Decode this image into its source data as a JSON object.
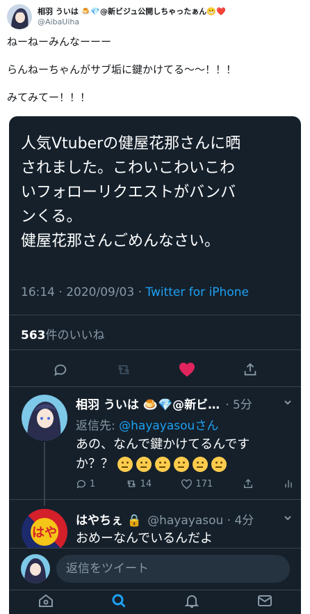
{
  "outer_tweet": {
    "name": "相羽 ういは 🍮💎@新ビジュ公開しちゃったぁん😬❤️",
    "handle": "@AibaUiha",
    "lines": [
      "ねーねーみんなーーー",
      "らんねーちゃんがサブ垢に鍵かけてる〜〜！！！",
      "みてみてー！！！"
    ]
  },
  "screenshot": {
    "tweet_lines": [
      "人気Vtuberの健屋花那さんに晒",
      "されました。こわいこわいこわ",
      "いフォローリクエストがバンバ",
      "ンくる。",
      "健屋花那さんごめんなさい。"
    ],
    "time": "16:14 · 2020/09/03 · ",
    "source": "Twitter for iPhone",
    "likes_count": "563",
    "likes_label": "件のいいね",
    "reply": {
      "name": "相羽 ういは 🍮💎@新ビ…",
      "time": "· 5分",
      "replying_prefix": "返信先: ",
      "replying_handle": "@hayayasou",
      "replying_suffix": "さん",
      "text_line1": "あの、なんで鍵かけてるんです",
      "text_line2": "か？？",
      "reply_count": "1",
      "retweet_count": "14",
      "like_count": "171"
    },
    "reply2": {
      "name": "はやちぇ 🔒",
      "handle_time": "@hayayasou · 4分",
      "text": "おめーなんでいるんだよ"
    },
    "compose_placeholder": "返信をツイート"
  },
  "colors": {
    "dark_bg": "#15202b",
    "accent": "#1da1f2",
    "like_red": "#e0245e",
    "muted": "#8899a6"
  }
}
